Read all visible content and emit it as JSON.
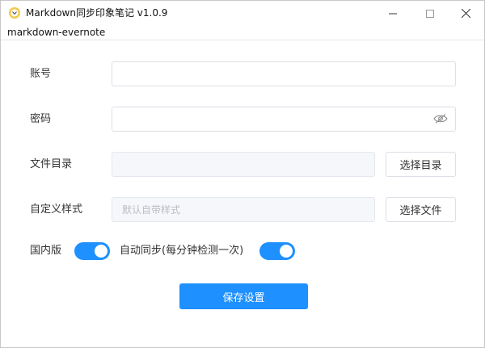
{
  "window": {
    "title": "Markdown同步印象笔记 v1.0.9",
    "subtitle": "markdown-evernote"
  },
  "form": {
    "account": {
      "label": "账号",
      "value": ""
    },
    "password": {
      "label": "密码",
      "value": "",
      "icon": "eye-off-icon"
    },
    "directory": {
      "label": "文件目录",
      "value": "",
      "button": "选择目录"
    },
    "style": {
      "label": "自定义样式",
      "placeholder": "默认自带样式",
      "button": "选择文件"
    },
    "toggles": {
      "domestic": {
        "label": "国内版",
        "on": true
      },
      "auto_sync": {
        "label": "自动同步(每分钟检测一次)",
        "on": true
      }
    },
    "save_button": "保存设置"
  },
  "colors": {
    "accent": "#1e90ff"
  }
}
